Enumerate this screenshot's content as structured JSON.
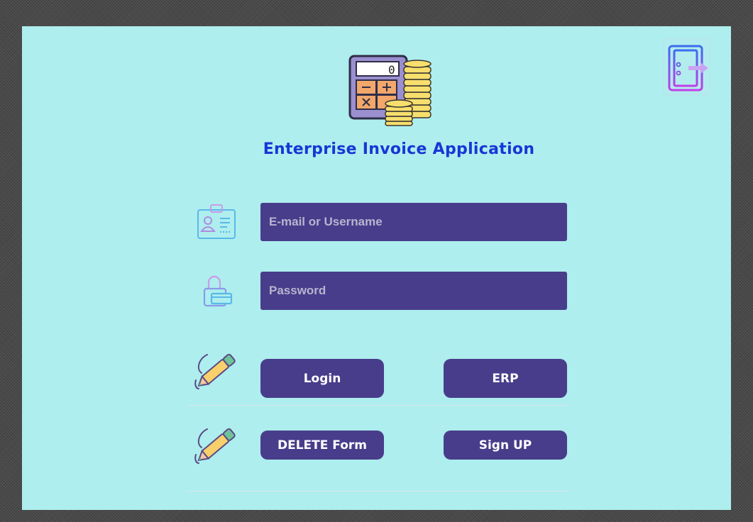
{
  "app": {
    "title": "Enterprise Invoice Application",
    "logo_icon": "calculator-coins-icon"
  },
  "header": {
    "exit_icon": "exit-door-icon"
  },
  "form": {
    "username": {
      "placeholder": "E-mail or Username",
      "value": "",
      "icon": "id-badge-icon"
    },
    "password": {
      "placeholder": "Password",
      "value": "",
      "icon": "padlock-icon"
    }
  },
  "actions": {
    "row1_icon": "pencil-icon",
    "row2_icon": "pencil-icon",
    "login_label": "Login",
    "erp_label": "ERP",
    "delete_label": "DELETE Form",
    "signup_label": "Sign UP"
  },
  "colors": {
    "background": "#aeeeee",
    "accent": "#483d8b",
    "title": "#1836d6"
  }
}
